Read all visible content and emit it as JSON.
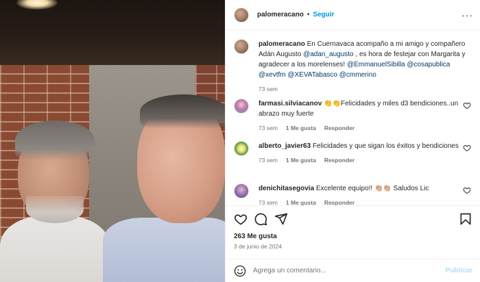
{
  "header": {
    "username": "palomeracano",
    "separator": "•",
    "follow": "Seguir",
    "more": "···"
  },
  "caption": {
    "username": "palomeracano",
    "text_1": " En Cuernavaca acompaño a mi amigo y compañero Adán Augusto ",
    "mention_1": "@adan_augusto",
    "text_2": " , es hora de festejar con Margarita y agradecer a los morelenses! ",
    "mention_2": "@EmmanuelSibilla",
    "mention_3": "@cosapublica",
    "mention_4": "@xevtfm",
    "mention_5": "@XEVATabasco",
    "mention_6": "@cmmerino",
    "age": "73 sem"
  },
  "comments": [
    {
      "username": "farmasi.silviacanov",
      "text": " 👏👏Felicidades y miles d3 bendiciones..un abrazo muy fuerte",
      "age": "73 sem",
      "likes": "1 Me gusta",
      "reply": "Responder"
    },
    {
      "username": "alberto_javier63",
      "text": " Felicidades y que sigan los éxitos y bendiciones",
      "age": "73 sem",
      "likes": "1 Me gusta",
      "reply": "Responder"
    },
    {
      "username": "denichitasegovia",
      "text": " Excelente equipo!! 👏🏼👏🏼 Saludos Lic",
      "age": "73 sem",
      "likes": "1 Me gusta",
      "reply": "Responder"
    }
  ],
  "stats": {
    "likes": "263 Me gusta",
    "date": "3 de junio de 2024"
  },
  "add_comment": {
    "placeholder": "Agrega un comentario...",
    "publish": "Publicar"
  },
  "icons": {
    "like": "heart-icon",
    "comment": "comment-icon",
    "share": "share-icon",
    "save": "bookmark-icon",
    "emoji": "emoji-icon",
    "more": "more-icon"
  },
  "colors": {
    "link": "#0095f6",
    "mention": "#00376b",
    "muted": "#737373",
    "publish_disabled": "#b2dffc"
  }
}
